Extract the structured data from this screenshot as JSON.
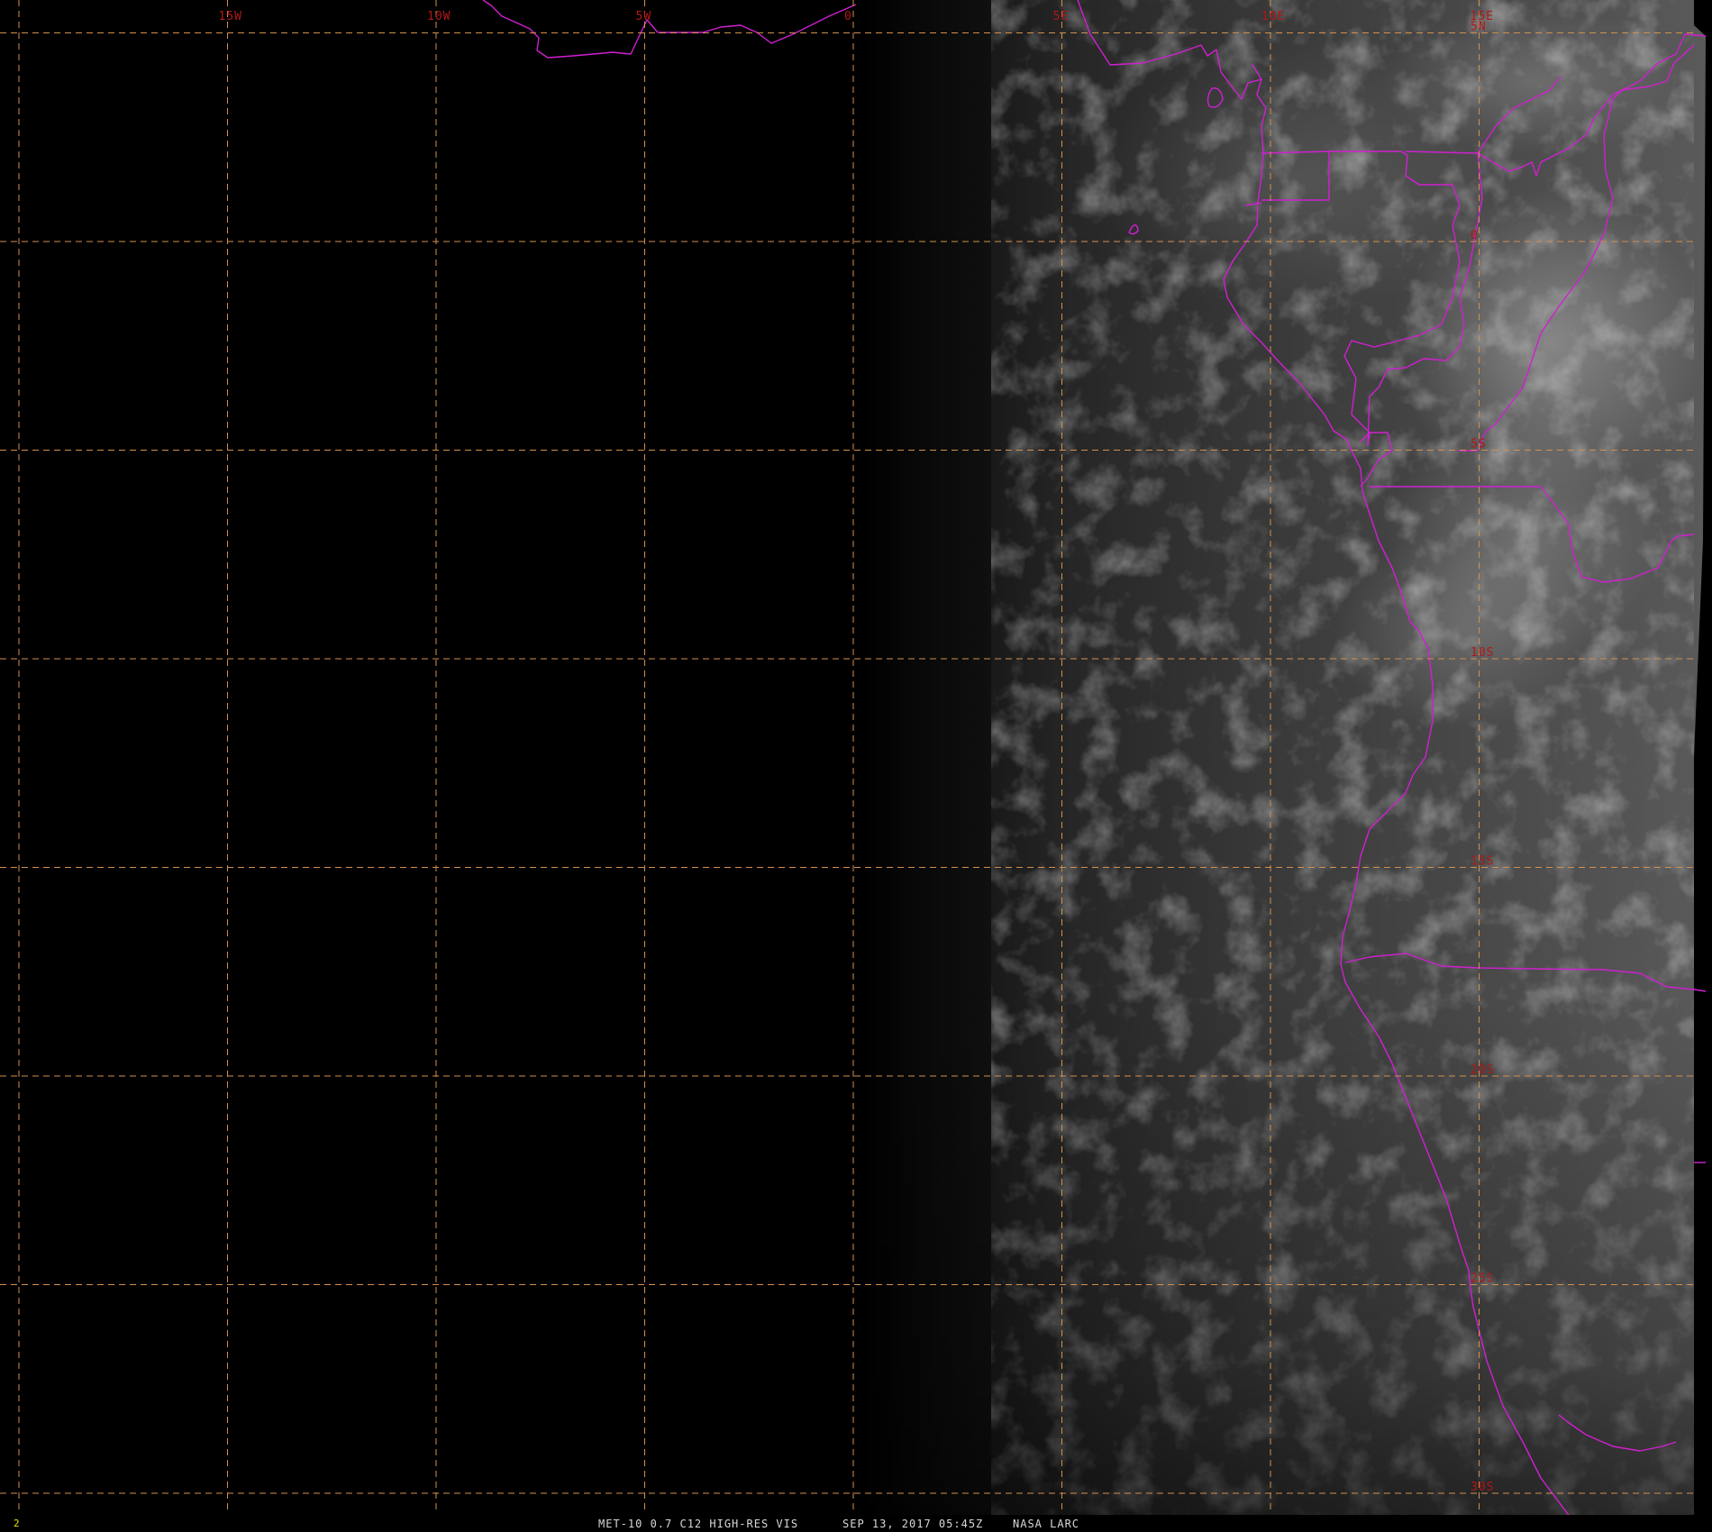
{
  "map": {
    "colors": {
      "background": "#000000",
      "gridline": "#d2904f",
      "gridlabel": "#b01818",
      "boundary": "#d020d0",
      "status_text": "#d8d8d8",
      "frame_number": "#e0e000"
    },
    "grid": {
      "longitudes": [
        {
          "value": -20,
          "label": ""
        },
        {
          "value": -15,
          "label": "15W"
        },
        {
          "value": -10,
          "label": "10W"
        },
        {
          "value": -5,
          "label": "5W"
        },
        {
          "value": 0,
          "label": "0"
        },
        {
          "value": 5,
          "label": "5E"
        },
        {
          "value": 10,
          "label": "10E"
        },
        {
          "value": 15,
          "label": "15E"
        }
      ],
      "latitudes": [
        {
          "value": 5,
          "label": "5N"
        },
        {
          "value": 0,
          "label": "0"
        },
        {
          "value": -5,
          "label": "5S"
        },
        {
          "value": -10,
          "label": "10S"
        },
        {
          "value": -15,
          "label": "15S"
        },
        {
          "value": -20,
          "label": "20S"
        },
        {
          "value": -25,
          "label": "25S"
        },
        {
          "value": -30,
          "label": "30S"
        }
      ]
    }
  },
  "status_bar": {
    "frame_number": "2",
    "product": "MET-10 0.7 C12 HIGH-RES VIS",
    "datetime": "SEP 13, 2017 05:45Z",
    "source": "NASA LARC"
  }
}
